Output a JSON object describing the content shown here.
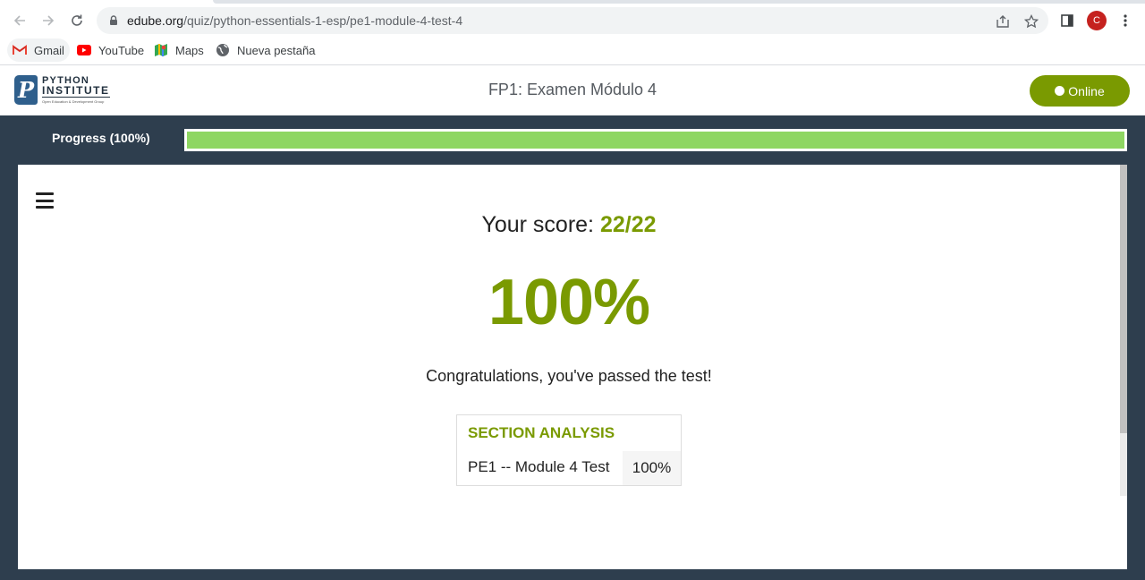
{
  "browser": {
    "url_host": "edube.org",
    "url_path": "/quiz/python-essentials-1-esp/pe1-module-4-test-4",
    "avatar_letter": "C",
    "icons": [
      "back-icon",
      "forward-icon",
      "reload-icon",
      "lock-icon",
      "share-icon",
      "star-icon",
      "side-panel-icon",
      "menu-dots-icon"
    ]
  },
  "bookmarks": [
    {
      "label": "Gmail",
      "icon": "gmail-icon"
    },
    {
      "label": "YouTube",
      "icon": "youtube-icon"
    },
    {
      "label": "Maps",
      "icon": "maps-icon"
    },
    {
      "label": "Nueva pestaña",
      "icon": "globe-icon"
    }
  ],
  "header": {
    "logo_line1": "PYTHON",
    "logo_line2": "INSTITUTE",
    "logo_tagline": "Open Education & Development Group",
    "title": "FP1: Examen Módulo 4",
    "online_label": "Online"
  },
  "progress": {
    "label": "Progress (100%)",
    "value": 1.0
  },
  "result": {
    "score_prefix": "Your score: ",
    "score_value": "22/22",
    "percent": "100%",
    "message": "Congratulations, you've passed the test!"
  },
  "analysis": {
    "heading": "SECTION ANALYSIS",
    "rows": [
      {
        "name": "PE1 -- Module 4 Test",
        "score": "100%"
      }
    ]
  },
  "colors": {
    "accent": "#7a9a01",
    "progress_fill": "#8ed662",
    "dark_bg": "#2e3e4e"
  }
}
